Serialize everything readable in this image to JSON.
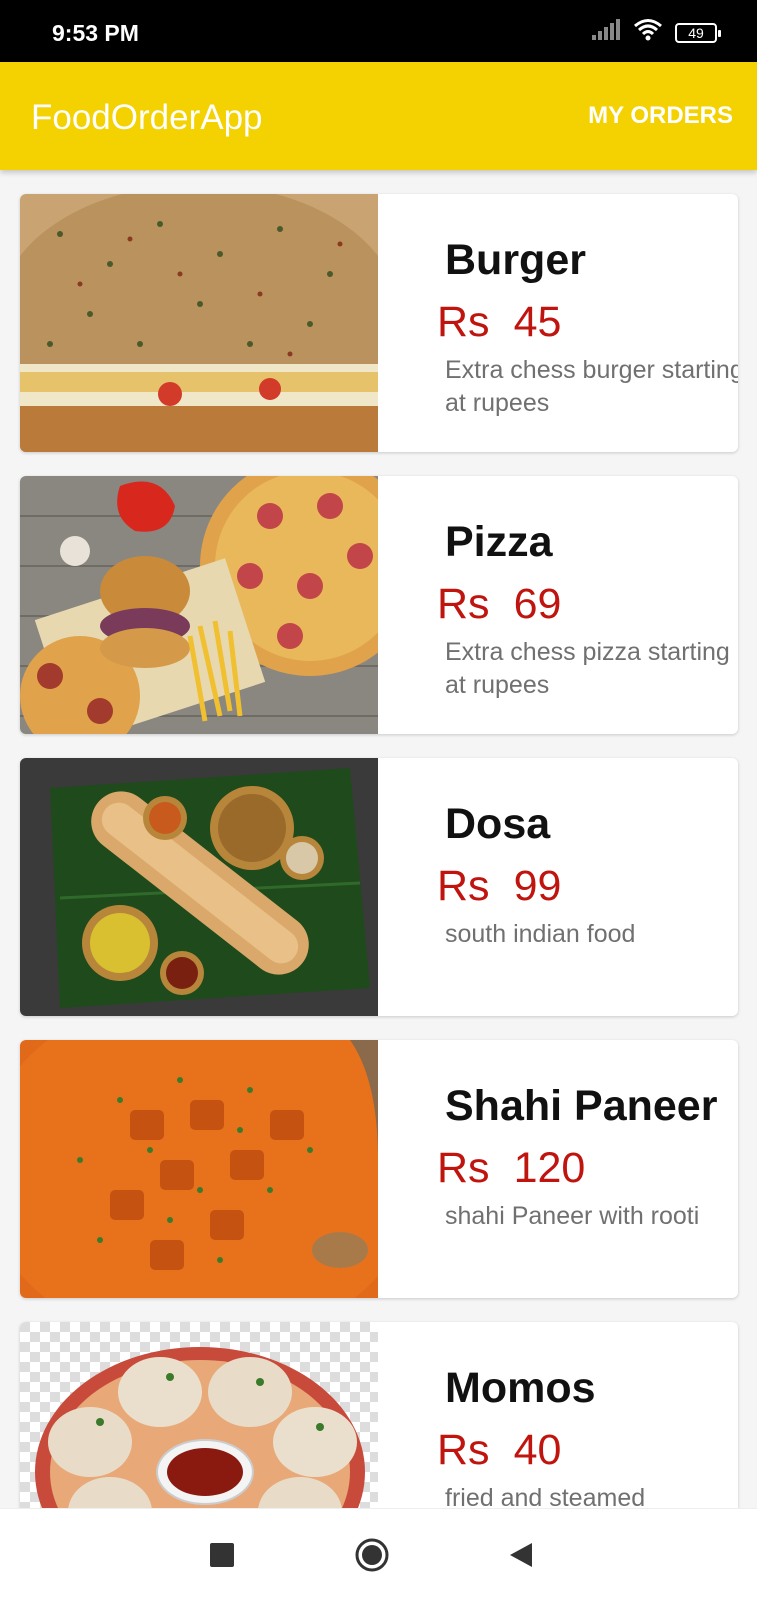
{
  "status_bar": {
    "time": "9:53 PM",
    "battery": "49",
    "icons": [
      "signal-icon",
      "wifi-icon",
      "battery-icon"
    ]
  },
  "app_bar": {
    "title": "FoodOrderApp",
    "orders_label": "MY ORDERS",
    "color": "#f4d100"
  },
  "colors": {
    "price": "#c0140f",
    "name": "#111111",
    "desc": "#707070"
  },
  "items": [
    {
      "name": "Burger",
      "currency": "Rs",
      "price": "45",
      "desc": "Extra chess burger starting at rupees",
      "image": "burger-image"
    },
    {
      "name": "Pizza",
      "currency": "Rs",
      "price": "69",
      "desc": "Extra chess pizza starting at rupees",
      "image": "pizza-image"
    },
    {
      "name": "Dosa",
      "currency": "Rs",
      "price": "99",
      "desc": "south indian food",
      "image": "dosa-image"
    },
    {
      "name": "Shahi Paneer",
      "currency": "Rs",
      "price": "120",
      "desc": "shahi Paneer with rooti",
      "image": "shahi-paneer-image"
    },
    {
      "name": "Momos",
      "currency": "Rs",
      "price": "40",
      "desc": "fried and steamed",
      "image": "momos-image"
    }
  ],
  "nav_bar": {
    "icons": [
      "recents-icon",
      "home-icon",
      "back-icon"
    ]
  }
}
